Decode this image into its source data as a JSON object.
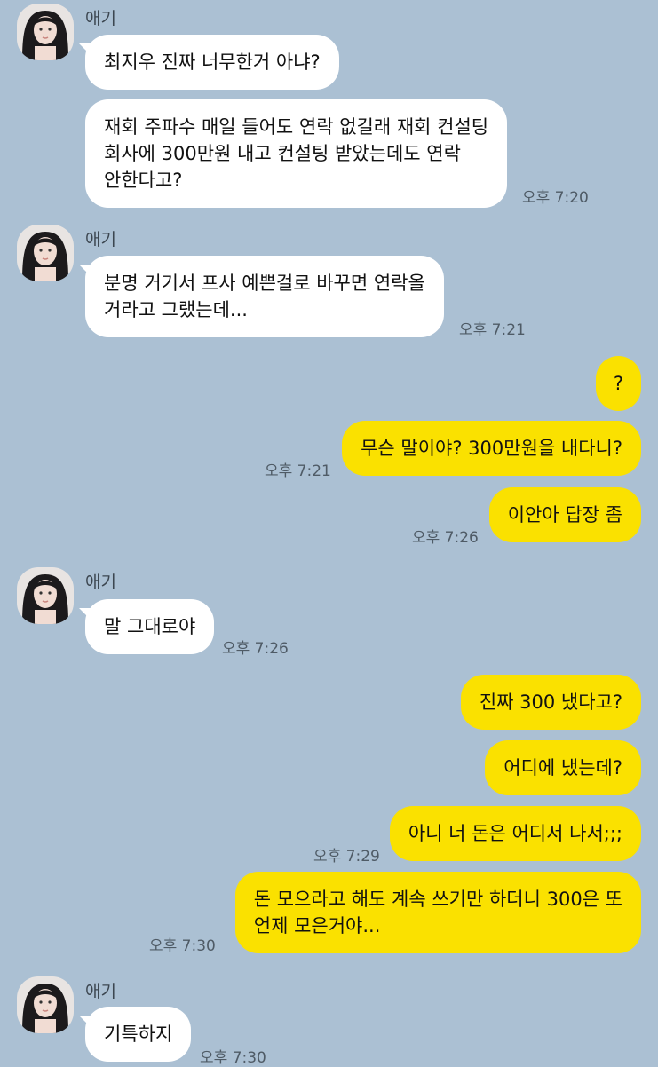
{
  "messages": {
    "g1": {
      "sender": "애기",
      "b1": "최지우 진짜 너무한거 아냐?",
      "b2_l1": "재회 주파수 매일 들어도 연락 없길래 재회 컨설팅",
      "b2_l2": "회사에 300만원 내고 컨설팅 받았는데도 연락",
      "b2_l3": "안한다고?",
      "time": "오후 7:20"
    },
    "g2": {
      "sender": "애기",
      "b1_l1": "분명 거기서 프사 예쁜걸로 바꾸면 연락올",
      "b1_l2": "거라고 그랬는데...",
      "time": "오후 7:21"
    },
    "g3": {
      "b1": "?",
      "b2": "무슨 말이야? 300만원을 내다니?",
      "time": "오후 7:21"
    },
    "g4": {
      "b1": "이안아 답장 좀",
      "time": "오후 7:26"
    },
    "g5": {
      "sender": "애기",
      "b1": "말 그대로야",
      "time": "오후 7:26"
    },
    "g6": {
      "b1": "진짜 300 냈다고?",
      "b2": "어디에 냈는데?",
      "b3": "아니 너 돈은 어디서 나서;;;",
      "time": "오후 7:29"
    },
    "g7": {
      "b1_l1": "돈 모으라고 해도 계속 쓰기만 하더니 300은 또",
      "b1_l2": "언제 모은거야...",
      "time": "오후 7:30"
    },
    "g8": {
      "sender": "애기",
      "b1": "기특하지",
      "time": "오후 7:30"
    }
  },
  "colors": {
    "background": "#abc0d3",
    "incoming_bubble": "#ffffff",
    "outgoing_bubble": "#fae100"
  },
  "icons": {
    "avatar": "profile-photo"
  }
}
